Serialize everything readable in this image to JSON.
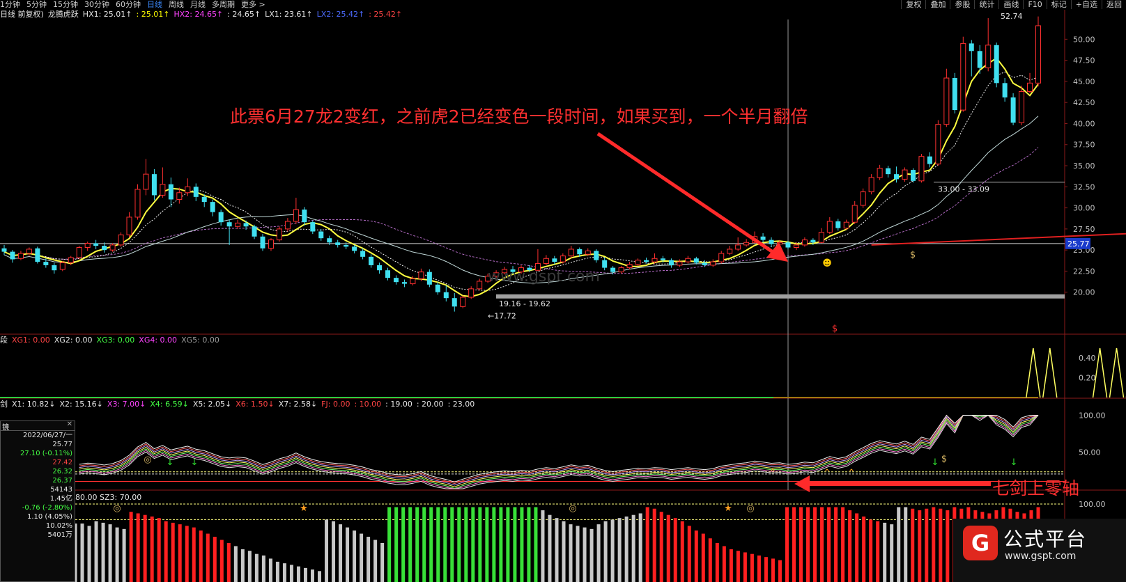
{
  "toolbar": {
    "periods": [
      "1分钟",
      "5分钟",
      "15分钟",
      "30分钟",
      "60分钟",
      "日线",
      "周线",
      "月线",
      "多周期",
      "更多 >"
    ],
    "active_period": "日线",
    "tools": [
      "复权",
      "叠加",
      "参股",
      "统计",
      "画线",
      "F10",
      "标记",
      "+自选",
      "返回"
    ]
  },
  "main_legend": {
    "prefix": "日线 前复权)",
    "name": "龙腾虎跃",
    "items": [
      {
        "text": "HX1: 25.01↑",
        "color": "#e6e6e6"
      },
      {
        "text": ": 25.01↑",
        "color": "#ffff00"
      },
      {
        "text": "HX2: 24.65↑",
        "color": "#ff44ff"
      },
      {
        "text": ": 24.65↑",
        "color": "#e6e6e6"
      },
      {
        "text": "LX1: 23.61↑",
        "color": "#e6e6e6"
      },
      {
        "text": "LX2: 25.42↑",
        "color": "#4d6bff"
      },
      {
        "text": ": 25.42↑",
        "color": "#ff4444"
      }
    ]
  },
  "xg_legend": {
    "prefix": "段",
    "items": [
      {
        "text": "XG1: 0.00",
        "color": "#ff4444"
      },
      {
        "text": "XG2: 0.00",
        "color": "#e6e6e6"
      },
      {
        "text": "XG3: 0.00",
        "color": "#44ff44"
      },
      {
        "text": "XG4: 0.00",
        "color": "#ff44ff"
      },
      {
        "text": "XG5: 0.00",
        "color": "#9a9a9a"
      }
    ]
  },
  "x_legend": {
    "prefix": "剑",
    "items": [
      {
        "text": "X1: 10.82↓",
        "color": "#e6e6e6"
      },
      {
        "text": "X2: 15.16↓",
        "color": "#e6e6e6"
      },
      {
        "text": "X3: 7.00↓",
        "color": "#ff44ff"
      },
      {
        "text": "X4: 6.59↓",
        "color": "#44ff44"
      },
      {
        "text": "X5: 2.05↓",
        "color": "#e6e6e6"
      },
      {
        "text": "X6: 1.50↓",
        "color": "#ff4444"
      },
      {
        "text": "X7: 2.58↓",
        "color": "#e6e6e6"
      },
      {
        "text": "FJ: 0.00",
        "color": "#ff4444"
      },
      {
        "text": ": 10.00",
        "color": "#ff4444"
      },
      {
        "text": ": 19.00",
        "color": "#e6e6e6"
      },
      {
        "text": ": 20.00",
        "color": "#e6e6e6"
      },
      {
        "text": ": 23.00",
        "color": "#e6e6e6"
      }
    ]
  },
  "sz_legend": {
    "text": "80.00  SZ3: 70.00"
  },
  "side_panel": {
    "title": "镜",
    "close": "✕",
    "rows": [
      {
        "text": "2022/06/27/一",
        "color": "#e6e6e6"
      },
      {
        "text": "25.77",
        "color": "#e6e6e6"
      },
      {
        "text": "27.10 (-0.11%)",
        "color": "#44ff44"
      },
      {
        "text": "27.42",
        "color": "#ff4444"
      },
      {
        "text": "26.32",
        "color": "#44ff44"
      },
      {
        "text": "26.37",
        "color": "#44ff44"
      },
      {
        "text": "54143",
        "color": "#e6e6e6"
      },
      {
        "text": "1.45亿",
        "color": "#e6e6e6"
      },
      {
        "text": "-0.76 (-2.80%)",
        "color": "#44ff44"
      },
      {
        "text": "1.10 (4.05%)",
        "color": "#e6e6e6"
      },
      {
        "text": "10.02%",
        "color": "#e6e6e6"
      },
      {
        "text": "5401万",
        "color": "#e6e6e6"
      }
    ]
  },
  "annotations": {
    "main": "此票6月27龙2变红，之前虎2已经变色一段时间，如果买到，一个半月翻倍",
    "seven_swords": "七剑上零轴"
  },
  "price_labels": {
    "current": "25.77",
    "high": "52.74",
    "low": "17.72",
    "range_low": "19.16 - 19.62",
    "range_mid": "33.00 - 33.09",
    "watermark": "www.gspt.com"
  },
  "logo": {
    "title": "公式平台",
    "url": "www.gspt.com",
    "badge": "G"
  },
  "chart_data": [
    {
      "type": "candlestick",
      "title": "龙腾虎跃",
      "ylim": [
        17.5,
        53
      ],
      "y_ticks": [
        20.0,
        22.5,
        25.0,
        27.5,
        30.0,
        32.5,
        35.0,
        37.5,
        40.0,
        42.5,
        45.0,
        47.5,
        50.0
      ],
      "horizontal_levels": [
        25.77,
        33.05,
        19.5
      ],
      "candles": [
        [
          25.2,
          24.8,
          25.6,
          24.4
        ],
        [
          24.8,
          23.9,
          25.0,
          23.5
        ],
        [
          24.0,
          24.6,
          24.9,
          23.8
        ],
        [
          24.6,
          25.1,
          25.3,
          24.3
        ],
        [
          25.2,
          23.6,
          25.4,
          23.4
        ],
        [
          23.6,
          23.2,
          24.0,
          22.9
        ],
        [
          23.2,
          22.6,
          23.5,
          22.2
        ],
        [
          22.7,
          23.5,
          23.7,
          22.5
        ],
        [
          23.5,
          24.1,
          24.3,
          23.2
        ],
        [
          24.1,
          25.3,
          25.5,
          23.9
        ],
        [
          25.3,
          25.8,
          26.0,
          24.9
        ],
        [
          25.8,
          25.5,
          26.2,
          25.1
        ],
        [
          25.5,
          25.0,
          25.9,
          24.7
        ],
        [
          25.0,
          25.6,
          25.8,
          24.8
        ],
        [
          25.6,
          26.8,
          27.1,
          25.4
        ],
        [
          26.8,
          28.9,
          29.5,
          26.5
        ],
        [
          28.9,
          32.2,
          32.8,
          28.6
        ],
        [
          32.2,
          34.0,
          35.8,
          31.5
        ],
        [
          34.0,
          31.5,
          34.6,
          30.9
        ],
        [
          31.5,
          32.8,
          34.8,
          31.2
        ],
        [
          32.8,
          31.0,
          33.6,
          30.1
        ],
        [
          31.0,
          31.8,
          32.4,
          30.5
        ],
        [
          31.8,
          32.5,
          33.5,
          31.4
        ],
        [
          32.5,
          31.3,
          32.9,
          30.8
        ],
        [
          31.3,
          30.7,
          31.6,
          30.1
        ],
        [
          30.7,
          29.5,
          31.0,
          29.0
        ],
        [
          29.5,
          28.3,
          29.8,
          27.9
        ],
        [
          28.3,
          27.8,
          28.6,
          25.6
        ],
        [
          27.8,
          28.2,
          28.6,
          27.5
        ],
        [
          28.2,
          27.8,
          28.5,
          27.4
        ],
        [
          27.8,
          26.6,
          28.0,
          26.3
        ],
        [
          26.6,
          25.2,
          26.9,
          24.9
        ],
        [
          25.2,
          26.2,
          26.4,
          24.9
        ],
        [
          26.2,
          27.5,
          27.8,
          26.0
        ],
        [
          27.5,
          28.4,
          28.8,
          27.2
        ],
        [
          28.4,
          29.8,
          31.2,
          28.1
        ],
        [
          29.8,
          28.3,
          30.1,
          27.9
        ],
        [
          28.3,
          27.2,
          28.5,
          26.9
        ],
        [
          27.2,
          26.4,
          27.5,
          26.1
        ],
        [
          26.4,
          25.9,
          26.7,
          25.6
        ],
        [
          25.9,
          25.6,
          26.2,
          25.3
        ],
        [
          25.6,
          25.4,
          25.9,
          25.1
        ],
        [
          25.4,
          24.9,
          25.6,
          24.6
        ],
        [
          24.9,
          24.2,
          25.2,
          23.9
        ],
        [
          24.2,
          23.2,
          24.5,
          22.9
        ],
        [
          23.2,
          22.6,
          23.5,
          22.2
        ],
        [
          22.6,
          21.7,
          22.9,
          21.4
        ],
        [
          21.7,
          21.2,
          22.0,
          20.9
        ],
        [
          21.2,
          21.0,
          21.5,
          20.6
        ],
        [
          21.0,
          21.6,
          21.9,
          20.8
        ],
        [
          21.6,
          22.4,
          22.8,
          21.3
        ],
        [
          22.4,
          20.9,
          22.7,
          20.6
        ],
        [
          20.9,
          20.0,
          21.2,
          19.7
        ],
        [
          20.0,
          19.3,
          20.8,
          18.9
        ],
        [
          19.3,
          18.3,
          19.9,
          17.7
        ],
        [
          18.3,
          19.4,
          19.6,
          18.1
        ],
        [
          19.4,
          20.4,
          20.7,
          19.2
        ],
        [
          20.4,
          21.3,
          21.6,
          20.2
        ],
        [
          21.3,
          21.9,
          22.2,
          21.1
        ],
        [
          21.9,
          22.3,
          22.6,
          21.7
        ],
        [
          22.3,
          22.7,
          23.0,
          22.1
        ],
        [
          22.7,
          22.4,
          23.1,
          22.2
        ],
        [
          22.4,
          22.9,
          23.2,
          22.2
        ],
        [
          22.9,
          22.6,
          23.2,
          22.4
        ],
        [
          22.6,
          23.4,
          25.1,
          22.5
        ],
        [
          23.4,
          24.0,
          24.4,
          23.2
        ],
        [
          24.0,
          23.6,
          24.3,
          23.3
        ],
        [
          23.6,
          24.3,
          24.6,
          23.4
        ],
        [
          24.3,
          25.1,
          25.5,
          24.0
        ],
        [
          25.1,
          24.5,
          25.3,
          24.2
        ],
        [
          24.5,
          24.9,
          25.2,
          24.3
        ],
        [
          24.9,
          23.8,
          25.1,
          23.5
        ],
        [
          23.8,
          22.9,
          24.1,
          22.6
        ],
        [
          22.9,
          22.4,
          23.1,
          22.1
        ],
        [
          22.4,
          22.9,
          23.1,
          22.2
        ],
        [
          22.9,
          23.3,
          23.6,
          22.7
        ],
        [
          23.3,
          23.8,
          24.0,
          23.1
        ],
        [
          23.8,
          23.6,
          24.1,
          23.4
        ],
        [
          23.6,
          24.0,
          24.6,
          23.4
        ],
        [
          24.0,
          23.8,
          24.3,
          23.5
        ],
        [
          23.8,
          23.2,
          24.0,
          22.9
        ],
        [
          23.2,
          23.6,
          23.9,
          23.0
        ],
        [
          23.6,
          24.0,
          24.3,
          23.4
        ],
        [
          24.0,
          23.5,
          24.2,
          23.3
        ],
        [
          23.5,
          23.2,
          23.8,
          23.0
        ],
        [
          23.2,
          23.6,
          23.9,
          23.0
        ],
        [
          23.6,
          24.6,
          24.9,
          23.4
        ],
        [
          24.6,
          25.1,
          25.5,
          24.4
        ],
        [
          25.1,
          25.6,
          26.5,
          24.9
        ],
        [
          25.6,
          25.9,
          26.3,
          25.4
        ],
        [
          25.9,
          26.6,
          27.2,
          25.8
        ],
        [
          26.6,
          26.2,
          27.0,
          25.9
        ],
        [
          26.2,
          25.7,
          26.5,
          25.4
        ],
        [
          25.7,
          25.9,
          26.2,
          25.5
        ],
        [
          25.9,
          25.3,
          26.1,
          25.1
        ],
        [
          25.3,
          25.6,
          25.9,
          25.0
        ],
        [
          25.6,
          26.2,
          26.5,
          25.4
        ],
        [
          26.2,
          25.9,
          26.4,
          25.6
        ],
        [
          25.9,
          27.1,
          27.6,
          25.8
        ],
        [
          27.1,
          28.4,
          28.9,
          26.9
        ],
        [
          28.4,
          27.6,
          28.7,
          27.3
        ],
        [
          27.6,
          28.3,
          28.6,
          27.4
        ],
        [
          28.3,
          30.3,
          30.8,
          28.1
        ],
        [
          30.3,
          31.9,
          32.3,
          30.0
        ],
        [
          31.9,
          33.6,
          34.0,
          31.6
        ],
        [
          33.6,
          34.7,
          35.1,
          33.3
        ],
        [
          34.7,
          34.0,
          35.0,
          33.6
        ],
        [
          34.0,
          33.4,
          34.9,
          33.0
        ],
        [
          33.4,
          34.5,
          34.8,
          33.1
        ],
        [
          34.5,
          33.2,
          34.7,
          33.0
        ],
        [
          33.2,
          36.1,
          36.4,
          33.0
        ],
        [
          36.1,
          35.2,
          36.6,
          34.8
        ],
        [
          35.2,
          39.9,
          40.4,
          35.0
        ],
        [
          39.9,
          45.4,
          46.5,
          39.6
        ],
        [
          45.4,
          41.6,
          46.0,
          41.2
        ],
        [
          41.6,
          49.5,
          50.3,
          41.4
        ],
        [
          49.5,
          48.6,
          49.9,
          45.6
        ],
        [
          48.6,
          46.6,
          49.3,
          45.9
        ],
        [
          46.6,
          49.3,
          52.5,
          46.2
        ],
        [
          49.3,
          44.8,
          49.6,
          44.3
        ],
        [
          44.8,
          43.1,
          45.4,
          42.6
        ],
        [
          43.1,
          40.1,
          43.6,
          39.8
        ],
        [
          40.1,
          43.8,
          44.5,
          39.8
        ],
        [
          43.8,
          44.8,
          46.0,
          43.6
        ],
        [
          44.8,
          51.6,
          52.7,
          44.4
        ]
      ]
    },
    {
      "type": "line",
      "title": "XG",
      "y_ticks": [
        0.2,
        0.4
      ],
      "spikes_x": [
        123.4,
        125.4,
        131.4,
        133.4,
        135.4
      ],
      "spike_height": 0.42
    },
    {
      "type": "line",
      "title": "X1-X7",
      "y_ticks": [
        50.0,
        100.0
      ],
      "ylim": [
        0,
        110
      ],
      "reference_levels": [
        19,
        20,
        23
      ]
    },
    {
      "type": "bar",
      "title": "SZ3",
      "y_ticks": [
        100.0
      ],
      "ylim": [
        0,
        100
      ],
      "values": [
        75,
        75,
        72,
        78,
        76,
        74,
        70,
        68,
        90,
        88,
        86,
        84,
        82,
        78,
        76,
        74,
        72,
        70,
        66,
        62,
        58,
        54,
        50,
        46,
        42,
        40,
        36,
        34,
        30,
        26,
        24,
        22,
        20,
        18,
        16,
        14,
        80,
        78,
        74,
        70,
        66,
        62,
        58,
        54,
        50,
        96,
        96,
        96,
        96,
        96,
        96,
        96,
        96,
        96,
        96,
        96,
        96,
        96,
        96,
        96,
        96,
        96,
        96,
        96,
        96,
        96,
        96,
        92,
        86,
        82,
        78,
        74,
        72,
        70,
        68,
        74,
        78,
        80,
        82,
        84,
        86,
        88,
        96,
        94,
        90,
        86,
        82,
        78,
        72,
        66,
        62,
        56,
        50,
        46,
        42,
        40,
        38,
        36,
        34,
        32,
        30,
        28,
        96,
        96,
        96,
        96,
        96,
        96,
        96,
        96,
        96,
        92,
        88,
        84,
        80,
        78,
        76,
        74,
        96,
        96,
        94,
        92,
        94,
        96,
        94,
        92,
        96,
        94,
        96,
        92,
        90,
        88,
        92,
        96,
        94,
        90,
        88,
        92,
        96
      ],
      "colors": [
        "#c8c8c8",
        "#c8c8c8",
        "#c8c8c8",
        "#c8c8c8",
        "#c8c8c8",
        "#c8c8c8",
        "#c8c8c8",
        "#c8c8c8",
        "#ff2020",
        "#ff2020",
        "#ff2020",
        "#ff2020",
        "#ff2020",
        "#ff2020",
        "#ff2020",
        "#ff2020",
        "#ff2020",
        "#ff2020",
        "#ff2020",
        "#ff2020",
        "#ff2020",
        "#ff2020",
        "#ff2020",
        "#c8c8c8",
        "#c8c8c8",
        "#c8c8c8",
        "#c8c8c8",
        "#c8c8c8",
        "#c8c8c8",
        "#c8c8c8",
        "#c8c8c8",
        "#c8c8c8",
        "#c8c8c8",
        "#c8c8c8",
        "#c8c8c8",
        "#c8c8c8",
        "#c8c8c8",
        "#c8c8c8",
        "#c8c8c8",
        "#c8c8c8",
        "#c8c8c8",
        "#c8c8c8",
        "#c8c8c8",
        "#c8c8c8",
        "#c8c8c8",
        "#38e038",
        "#38e038",
        "#38e038",
        "#38e038",
        "#38e038",
        "#38e038",
        "#38e038",
        "#38e038",
        "#38e038",
        "#38e038",
        "#38e038",
        "#38e038",
        "#38e038",
        "#38e038",
        "#38e038",
        "#38e038",
        "#38e038",
        "#38e038",
        "#38e038",
        "#38e038",
        "#38e038",
        "#38e038",
        "#c8c8c8",
        "#c8c8c8",
        "#c8c8c8",
        "#c8c8c8",
        "#c8c8c8",
        "#c8c8c8",
        "#c8c8c8",
        "#c8c8c8",
        "#c8c8c8",
        "#c8c8c8",
        "#c8c8c8",
        "#c8c8c8",
        "#c8c8c8",
        "#c8c8c8",
        "#c8c8c8",
        "#ff2020",
        "#ff2020",
        "#ff2020",
        "#ff2020",
        "#ff2020",
        "#ff2020",
        "#ff2020",
        "#ff2020",
        "#ff2020",
        "#ff2020",
        "#ff2020",
        "#ff2020",
        "#ff2020",
        "#ff2020",
        "#ff2020",
        "#ff2020",
        "#ff2020",
        "#ff2020",
        "#ff2020",
        "#ff2020",
        "#ff2020",
        "#ff2020",
        "#ff2020",
        "#ff2020",
        "#ff2020",
        "#ff2020",
        "#ff2020",
        "#ff2020",
        "#ff2020",
        "#ff2020",
        "#ff2020",
        "#ff2020",
        "#ff2020",
        "#ff2020",
        "#c8c8c8",
        "#c8c8c8",
        "#c8c8c8",
        "#c8c8c8",
        "#ff2020",
        "#ff2020",
        "#ff2020",
        "#ff2020",
        "#ff2020",
        "#ff2020",
        "#ff2020",
        "#ff2020",
        "#ff2020",
        "#ff2020",
        "#ff2020",
        "#ff2020",
        "#ff2020",
        "#ff2020",
        "#ff2020",
        "#ff2020",
        "#ff2020",
        "#ff2020",
        "#ff2020",
        "#ff2020",
        "#ff2020"
      ]
    }
  ]
}
